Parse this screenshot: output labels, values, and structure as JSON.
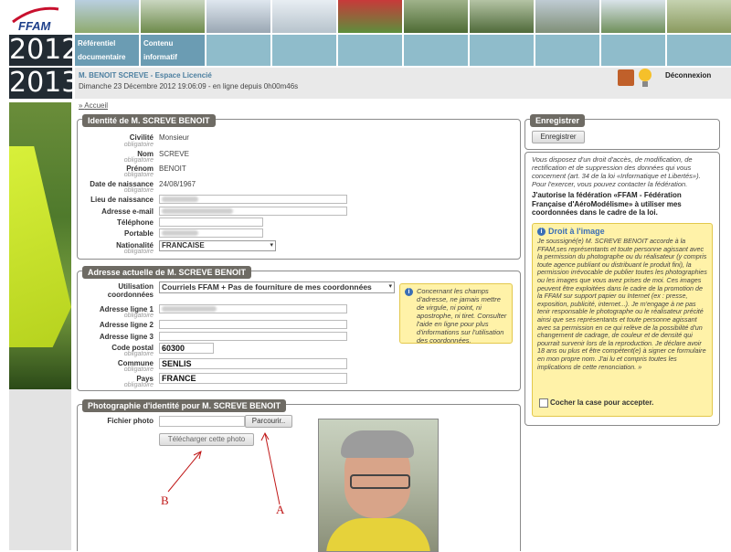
{
  "header": {
    "logo_text": "FFAM",
    "menu": [
      "Référentiel documentaire",
      "Contenu informatif",
      "",
      "",
      "",
      "",
      "",
      "",
      "",
      ""
    ],
    "years": [
      "2012",
      "2013"
    ],
    "user_name": "M. BENOIT SCREVE",
    "user_space": " - Espace Licencié",
    "date_line": "Dimanche 23 Décembre 2012 19:06:09 - en ligne depuis 0h00m46s",
    "logout": "Déconnexion"
  },
  "breadcrumb": "Accueil",
  "identity": {
    "title": "Identité de M. SCREVE BENOIT",
    "required": "obligatoire",
    "civilite_label": "Civilité",
    "civilite": "Monsieur",
    "nom_label": "Nom",
    "nom": "SCREVE",
    "prenom_label": "Prénom",
    "prenom": "BENOIT",
    "dob_label": "Date de naissance",
    "dob": "24/08/1967",
    "lieu_label": "Lieu de naissance",
    "email_label": "Adresse e-mail",
    "tel_label": "Téléphone",
    "portable_label": "Portable",
    "nat_label": "Nationalité",
    "nat": "FRANCAISE"
  },
  "address": {
    "title": "Adresse actuelle de M. SCREVE BENOIT",
    "usage_label": "Utilisation coordonnées",
    "usage_value": "Courriels FFAM + Pas de fourniture de mes coordonnées",
    "l1_label": "Adresse ligne 1",
    "l2_label": "Adresse ligne 2",
    "l3_label": "Adresse ligne 3",
    "cp_label": "Code postal",
    "cp": "60300",
    "commune_label": "Commune",
    "commune": "SENLIS",
    "pays_label": "Pays",
    "pays": "FRANCE",
    "info": "Concernant les champs d'adresse, ne jamais mettre de virgule, ni point, ni apostrophe, ni tiret. Consulter l'aide en ligne pour plus d'informations sur l'utilisation des coordonnées."
  },
  "photo": {
    "title": "Photographie d'identité pour M. SCREVE BENOIT",
    "file_label": "Fichier photo",
    "browse": "Parcourir..",
    "upload": "Télécharger cette photo",
    "annot_a": "A",
    "annot_b": "B"
  },
  "save": {
    "title": "Enregistrer",
    "button": "Enregistrer"
  },
  "privacy": {
    "text": "Vous disposez d'un droit d'accès, de modification, de rectification et de suppression des données qui vous concernent (art. 34 de la loi «Informatique et Libertés»). Pour l'exercer, vous pouvez contacter la fédération.",
    "bold": "J'autorise la fédération «FFAM - Fédération Française d'AéroModélisme» à utiliser mes coordonnées dans le cadre de la loi.",
    "image_title": "Droit à l'image",
    "image_text": "Je soussigné(e) M. SCREVE BENOIT accorde à la FFAM,ses représentants et toute personne agissant avec la permission du photographe ou du réalisateur (y compris toute agence publiant ou distribuant le produit fini), la permission irrévocable de publier toutes les photographies ou les images que vous avez prises de moi. Ces images peuvent être exploitées dans le cadre de la promotion de la FFAM sur support papier ou Internet (ex : presse, exposition, publicité, internet...). Je m'engage à ne pas tenir responsable le photographe ou le réalisateur précité ainsi que ses représentants et toute personne agissant avec sa permission en ce qui relève de la possibilité d'un changement de cadrage, de couleur et de densité qui pourrait survenir lors de la reproduction. Je déclare avoir 18 ans ou plus et être compétent(e) à signer ce formulaire en mon propre nom. J'ai lu et compris toutes les implications de cette renonciation. »",
    "accept": "Cocher la case pour accepter."
  }
}
